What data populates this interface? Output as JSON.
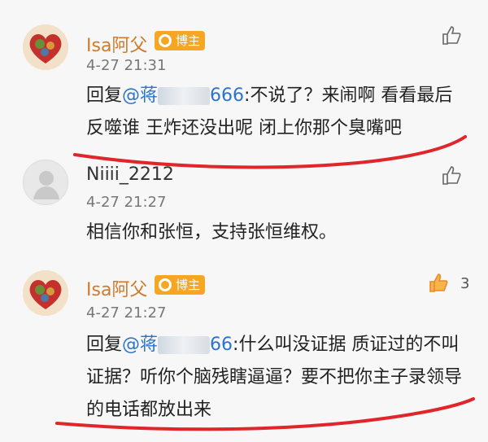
{
  "comments": [
    {
      "username": "Isa阿父",
      "badge": "博主",
      "time": "4-27 21:31",
      "reply_prefix": "回复",
      "mention_start": "@蒋",
      "mention_end": "666",
      "text": ":不说了？来闹啊 看看最后反噬谁 王炸还没出呢 闭上你那个臭嘴吧",
      "likes": ""
    },
    {
      "username": "Niiii_2212",
      "time": "4-27 21:27",
      "text": "相信你和张恒，支持张恒维权。",
      "likes": ""
    },
    {
      "username": "Isa阿父",
      "badge": "博主",
      "time": "4-27 21:27",
      "reply_prefix": "回复",
      "mention_start": "@蒋",
      "mention_end": "66",
      "text": ":什么叫没证据 质证过的不叫证据？听你个脑残瞎逼逼？要不把你主子录领导的电话都放出来",
      "likes": "3"
    }
  ],
  "colors": {
    "username_vip": "#d07a2c",
    "mention": "#2c73c9",
    "badge": "#f5a623",
    "like_active": "#e88a2a",
    "annotation_line": "#e0262b"
  }
}
